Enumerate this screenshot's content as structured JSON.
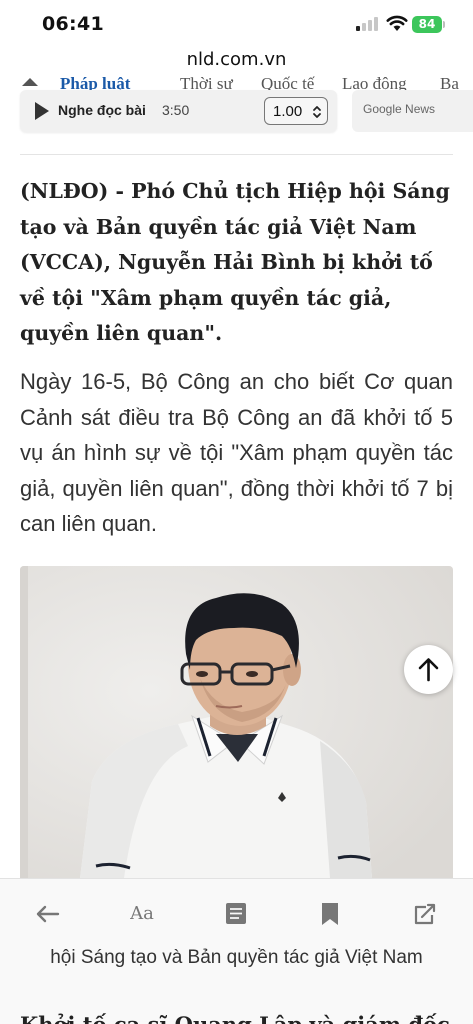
{
  "status_bar": {
    "time": "06:41",
    "battery": "84"
  },
  "browser": {
    "url": "nld.com.vn"
  },
  "category_nav": {
    "items": [
      "Pháp luật",
      "Thời sự",
      "Quốc tế",
      "Lao động",
      "Ba"
    ],
    "active_index": 0
  },
  "listen": {
    "label": "Nghe đọc bài",
    "duration": "3:50",
    "speed": "1.00"
  },
  "google_news": {
    "label": "Google News"
  },
  "article": {
    "lead": "(NLĐO) - Phó Chủ tịch Hiệp hội Sáng tạo và Bản quyền tác giả Việt Nam (VCCA), Nguyễn Hải Bình bị khởi tố về tội \"Xâm phạm quyền tác giả, quyền liên quan\".",
    "paragraph_1": "Ngày 16-5, Bộ Công an cho biết Cơ quan Cảnh sát điều tra Bộ Công an đã khởi tố 5 vụ án hình sự về tội \"Xâm phạm quyền tác giả, quyền liên quan\", đồng thời khởi tố 7 bị can liên quan.",
    "image_alt": "Nguyễn Hải Bình"
  },
  "toolbar": {
    "font_label": "Aa"
  },
  "caption": "hội Sáng tạo và Bản quyền tác giả Việt Nam",
  "next_heading": "Khởi tố ca sĩ Quang Lập và giám đốc",
  "colors": {
    "accent": "#1b5aa8",
    "battery": "#3cc65b"
  }
}
